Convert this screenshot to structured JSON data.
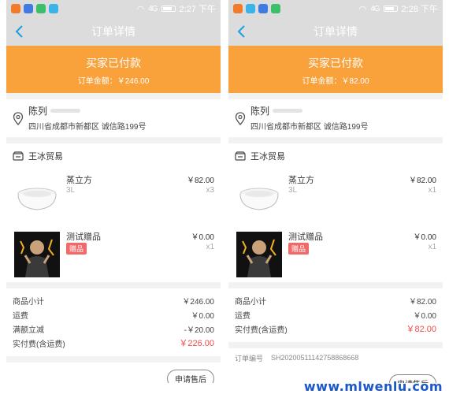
{
  "statusbar": {
    "left_time": "2:27 下午",
    "right_time": "2:28 下午",
    "signal": "4G"
  },
  "titlebar": {
    "title": "订单详情"
  },
  "orders": [
    {
      "banner_status": "买家已付款",
      "banner_amount": "订单金额：￥246.00",
      "address_name": "陈列",
      "address_line": "四川省成都市新都区 诚信路199号",
      "shop_name": "王冰贸易",
      "products": [
        {
          "name": "蒸立方",
          "sub": "3L",
          "price": "￥82.00",
          "qty": "x3"
        },
        {
          "name": "测试赠品",
          "tag": "赠品",
          "price": "￥0.00",
          "qty": "x1"
        }
      ],
      "summary": [
        {
          "label": "商品小计",
          "value": "￥246.00"
        },
        {
          "label": "运费",
          "value": "￥0.00"
        },
        {
          "label": "满额立减",
          "value": "-￥20.00"
        },
        {
          "label": "实付费(含运费)",
          "value": "￥226.00"
        }
      ],
      "after_sale": "申请售后"
    },
    {
      "banner_status": "买家已付款",
      "banner_amount": "订单金额：￥82.00",
      "address_name": "陈列",
      "address_line": "四川省成都市新都区 诚信路199号",
      "shop_name": "王冰贸易",
      "products": [
        {
          "name": "蒸立方",
          "sub": "3L",
          "price": "￥82.00",
          "qty": "x1"
        },
        {
          "name": "测试赠品",
          "tag": "赠品",
          "price": "￥0.00",
          "qty": "x1"
        }
      ],
      "summary": [
        {
          "label": "商品小计",
          "value": "￥82.00"
        },
        {
          "label": "运费",
          "value": "￥0.00"
        },
        {
          "label": "实付费(含运费)",
          "value": "￥82.00"
        }
      ],
      "order_no_label": "订单编号",
      "order_no": "SH20200511142758868668",
      "after_sale": "申请售后"
    }
  ],
  "watermark": "www.mlwenlu.com",
  "colors": {
    "accent_orange": "#f9a13a",
    "price_red": "#f04b4b",
    "header_gray": "#dcdcdc",
    "tag_red": "#f16a6a"
  },
  "icons": [
    "back-arrow-icon",
    "location-pin-icon",
    "shop-icon",
    "battery-icon",
    "wifi-icon"
  ]
}
